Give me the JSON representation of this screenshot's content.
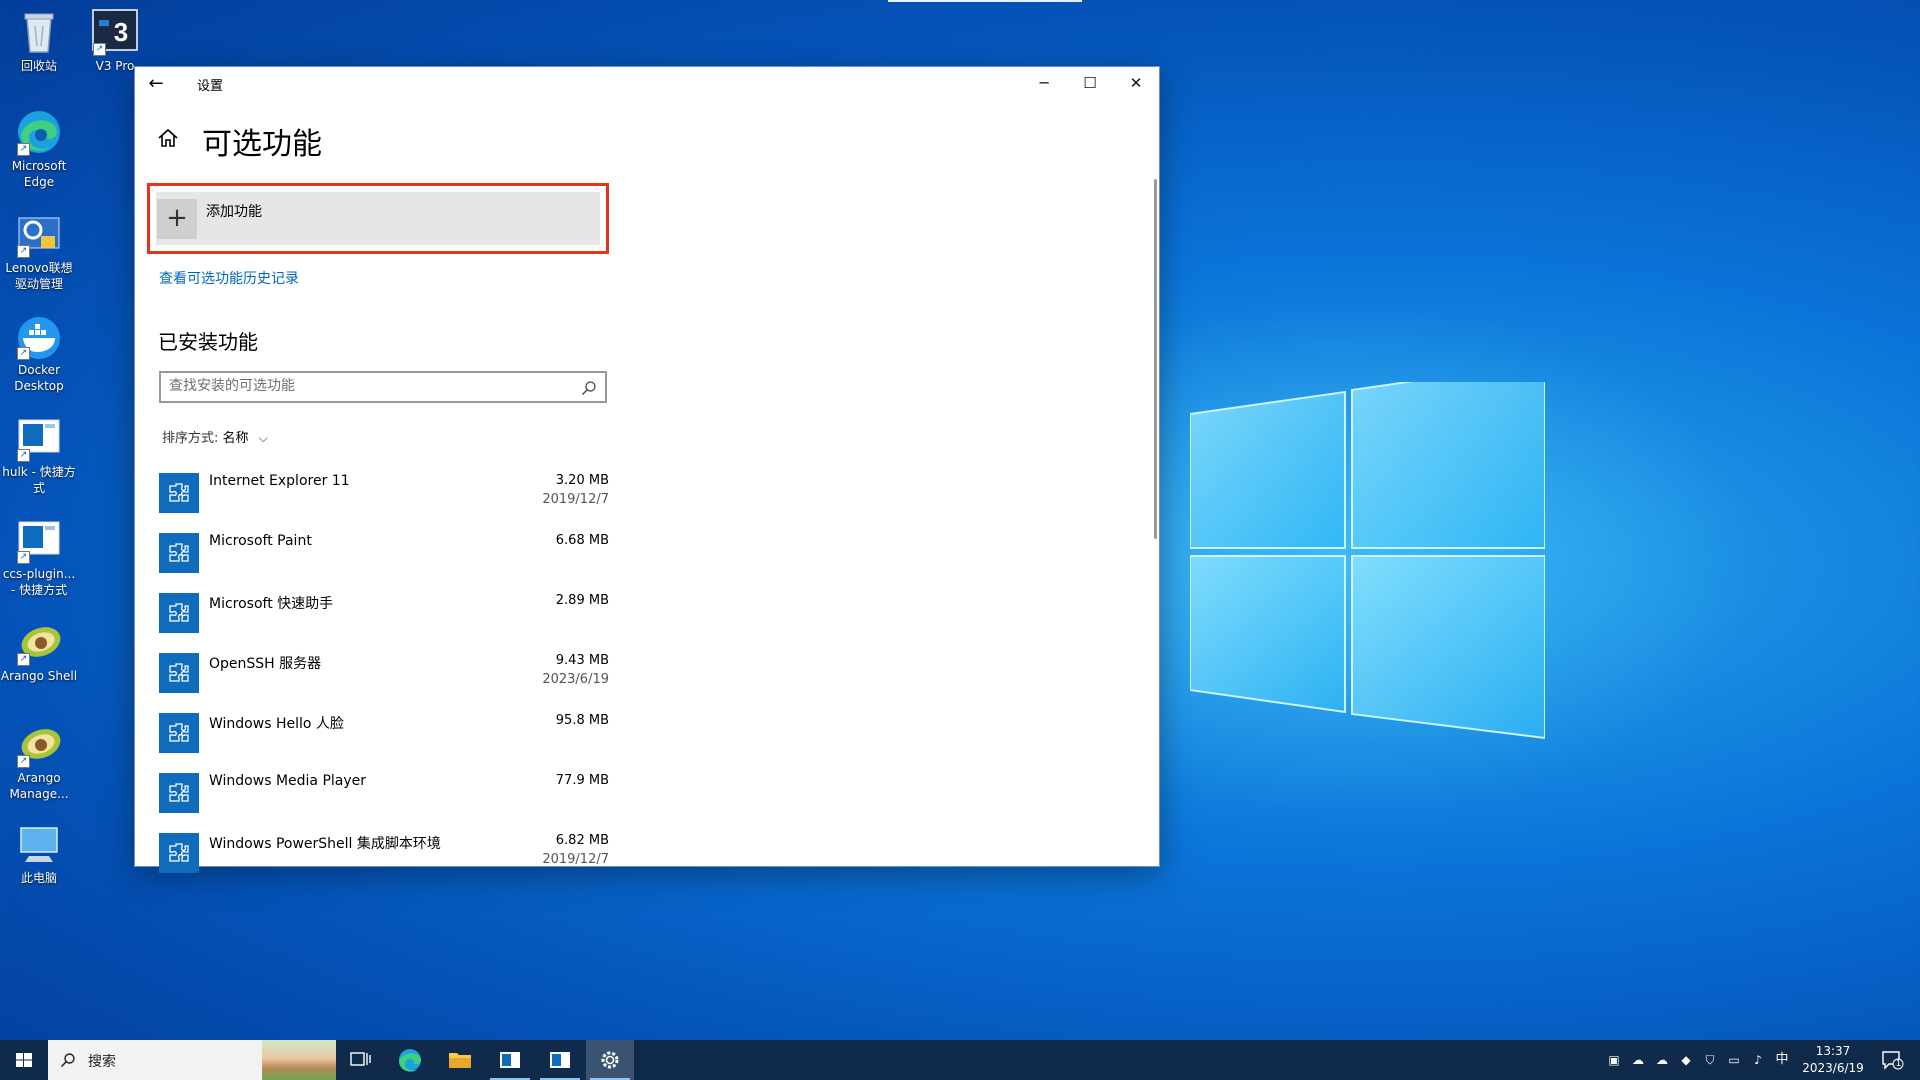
{
  "desktop": {
    "icons": [
      {
        "label": "回收站"
      },
      {
        "label": "V3 Pro"
      },
      {
        "label": "Microsoft Edge"
      },
      {
        "label": "Lenovo联想驱动管理"
      },
      {
        "label": "Docker Desktop"
      },
      {
        "label": "hulk - 快捷方式"
      },
      {
        "label": "ccs-plugin... - 快捷方式"
      },
      {
        "label": "Arango Shell"
      },
      {
        "label": "Arango Manage..."
      },
      {
        "label": "此电脑"
      }
    ]
  },
  "window": {
    "title": "设置",
    "back_glyph": "←",
    "minimize_glyph": "─",
    "maximize_glyph": "☐",
    "close_glyph": "✕"
  },
  "page": {
    "title": "可选功能",
    "add_feature_label": "添加功能",
    "add_plus_glyph": "+",
    "history_link": "查看可选功能历史记录",
    "installed_title": "已安装功能",
    "search_placeholder": "查找安装的可选功能",
    "sort_label": "排序方式:",
    "sort_value": "名称",
    "sort_chevron": "⌵"
  },
  "features": [
    {
      "name": "Internet Explorer 11",
      "size": "3.20 MB",
      "date": "2019/12/7"
    },
    {
      "name": "Microsoft Paint",
      "size": "6.68 MB",
      "date": ""
    },
    {
      "name": "Microsoft 快速助手",
      "size": "2.89 MB",
      "date": ""
    },
    {
      "name": "OpenSSH 服务器",
      "size": "9.43 MB",
      "date": "2023/6/19"
    },
    {
      "name": "Windows Hello 人脸",
      "size": "95.8 MB",
      "date": ""
    },
    {
      "name": "Windows Media Player",
      "size": "77.9 MB",
      "date": ""
    },
    {
      "name": "Windows PowerShell 集成脚本环境",
      "size": "6.82 MB",
      "date": "2019/12/7"
    }
  ],
  "taskbar": {
    "search_text": "搜索",
    "ime": "中",
    "time": "13:37",
    "date": "2023/6/19",
    "notification_count": "1"
  },
  "colors": {
    "accent": "#0f6cbd",
    "highlight_border": "#e8321e",
    "link": "#0067c0"
  }
}
